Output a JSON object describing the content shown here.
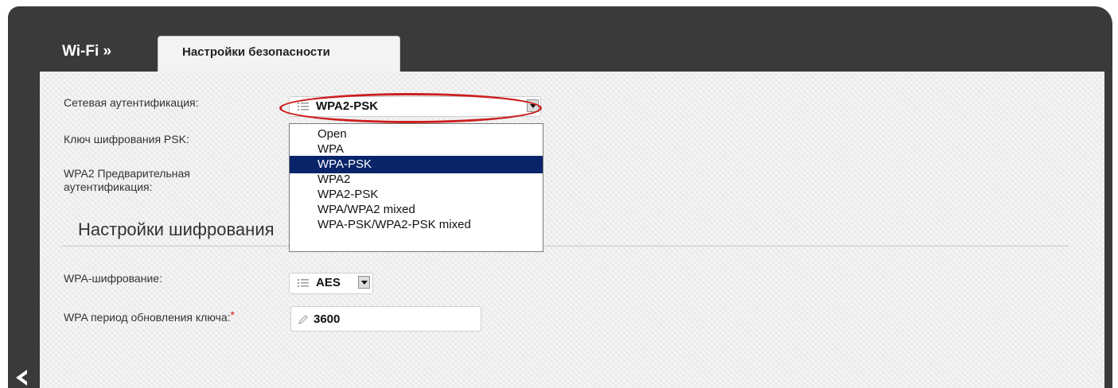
{
  "header": {
    "title": "Wi-Fi »",
    "tab_label": "Настройки безопасности"
  },
  "form": {
    "network_auth_label": "Сетевая аутентификация:",
    "network_auth_value": "WPA2-PSK",
    "psk_key_label": "Ключ шифрования PSK:",
    "wpa2_preauth_label": "WPA2 Предварительная аутентификация:",
    "encryption_section_title": "Настройки шифрования",
    "wpa_encryption_label": "WPA-шифрование:",
    "wpa_encryption_value": "AES",
    "key_update_label": "WPA период обновления ключа:",
    "key_update_required_mark": "*",
    "key_update_value": "3600"
  },
  "dropdown": {
    "options": [
      "Open",
      "WPA",
      "WPA-PSK",
      "WPA2",
      "WPA2-PSK",
      "WPA/WPA2 mixed",
      "WPA-PSK/WPA2-PSK mixed"
    ],
    "highlighted_option": "WPA-PSK"
  },
  "colors": {
    "frame": "#3a3a3a",
    "content_bg": "#eeeeee",
    "highlight_ellipse": "#cc1f1f",
    "selected_option_bg": "#0a246a",
    "required_mark": "#d81f1f"
  },
  "icons": {
    "back": "chevron-left-icon",
    "list": "list-icon",
    "pencil": "pencil-icon",
    "dropdown_arrow": "chevron-down-icon"
  }
}
